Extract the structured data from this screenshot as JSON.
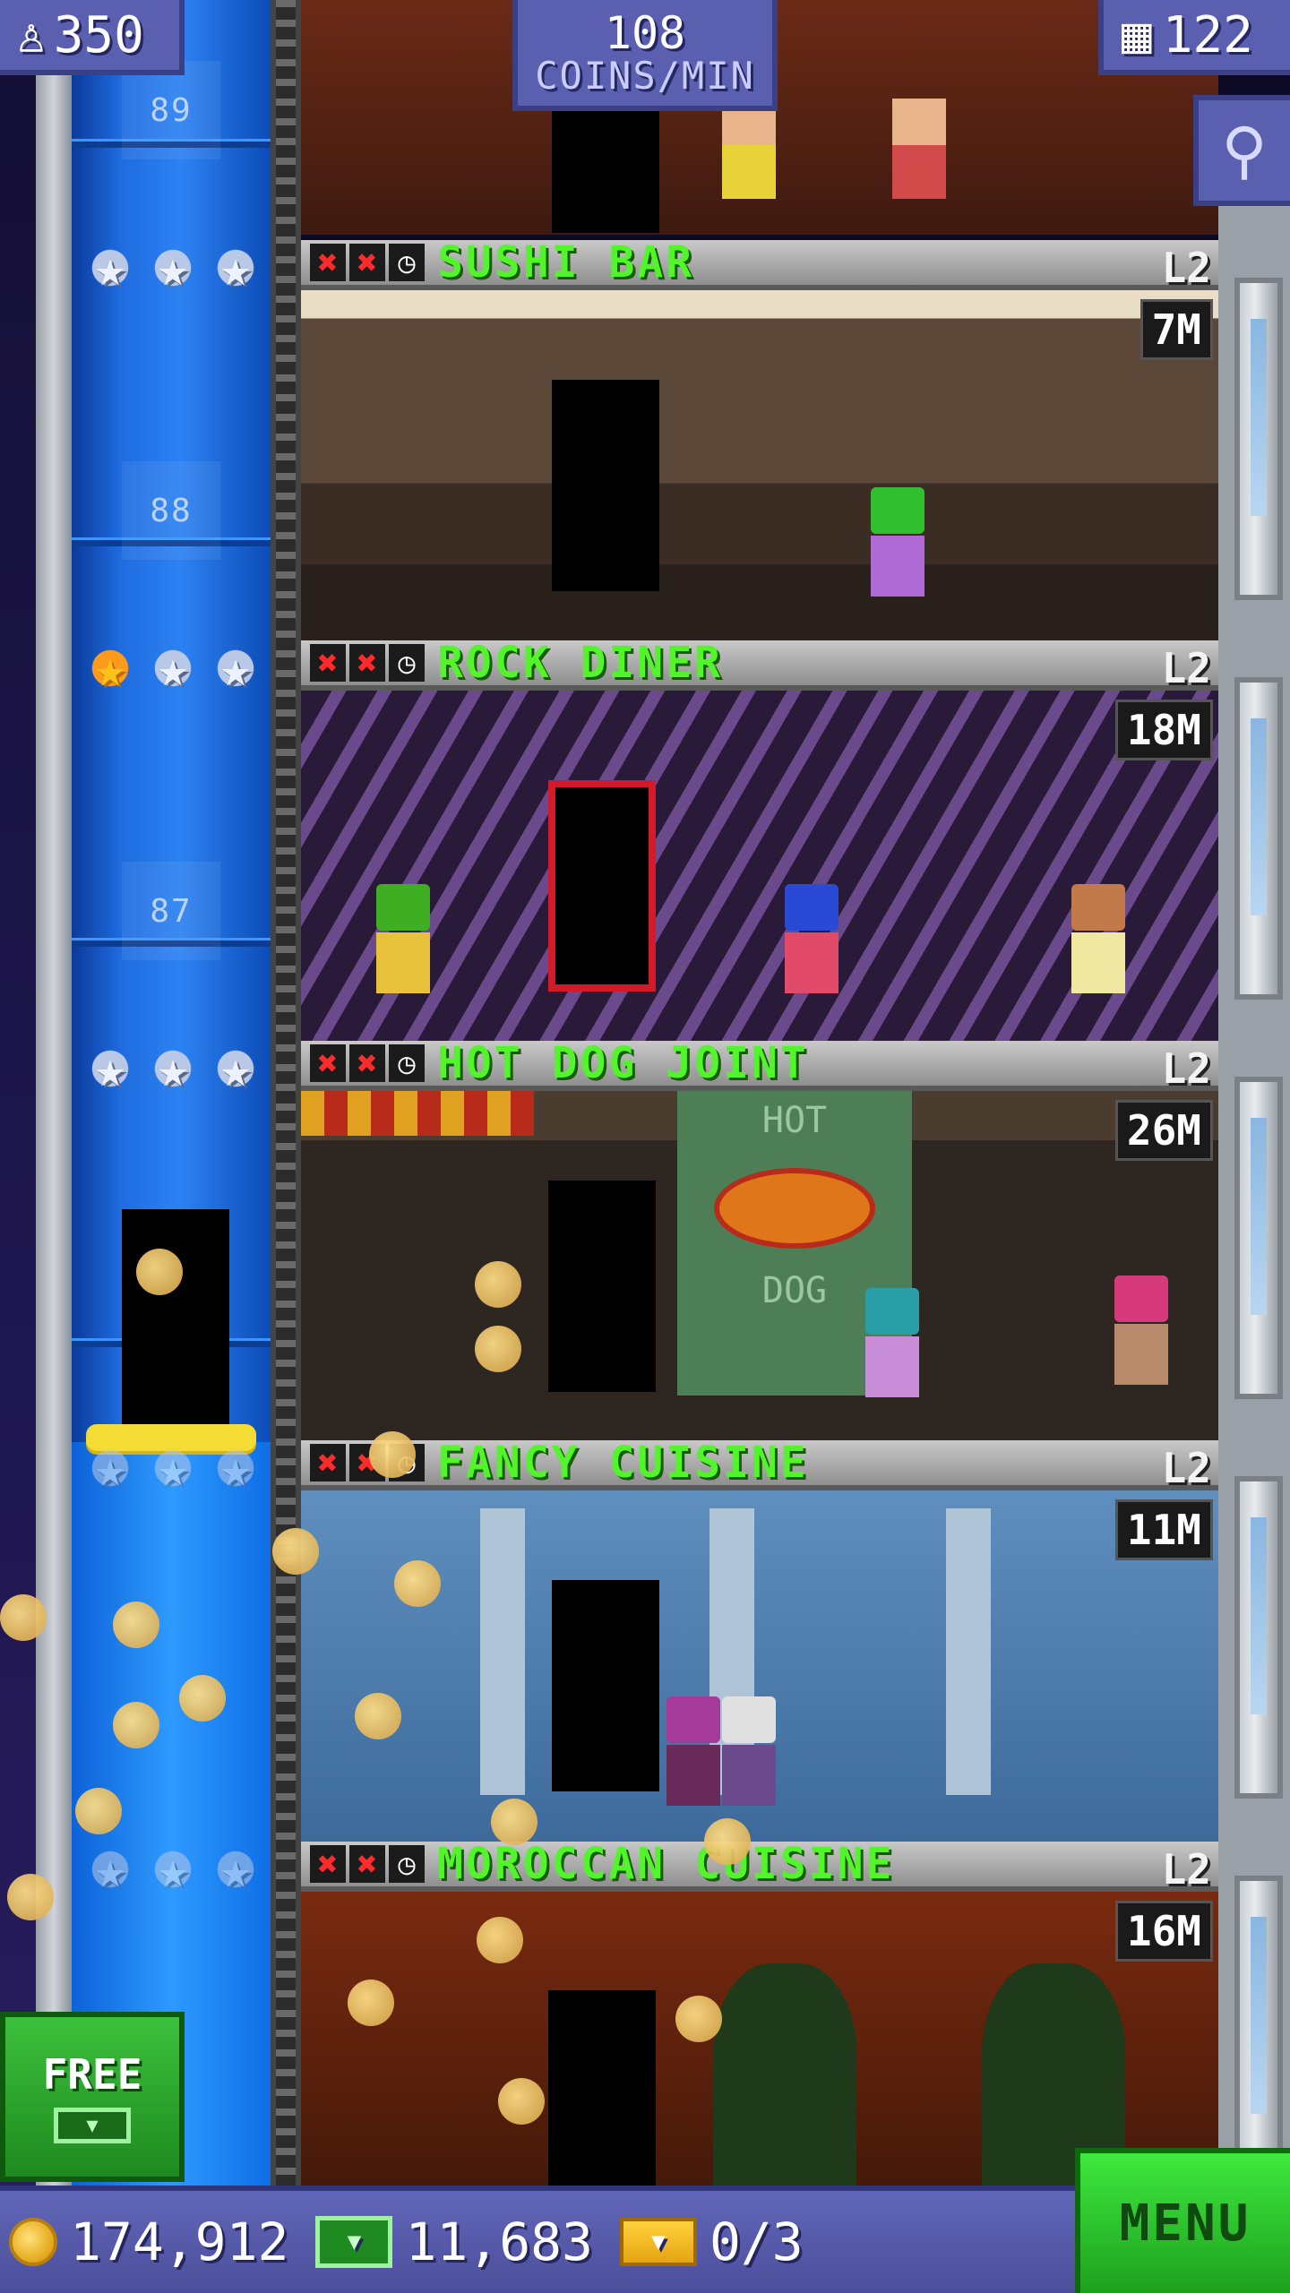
{
  "hud": {
    "population": "350",
    "coins_per_min_value": "108",
    "coins_per_min_unit": "COINS/MIN",
    "floor_count": "122"
  },
  "shaft_floor_numbers": [
    "89",
    "88",
    "87"
  ],
  "floors": [
    {
      "name": "SUSHI BAR",
      "level": "L2",
      "price": "7M",
      "stars": [
        false,
        false,
        false
      ]
    },
    {
      "name": "ROCK DINER",
      "level": "L2",
      "price": "18M",
      "stars": [
        true,
        false,
        false
      ]
    },
    {
      "name": "HOT DOG JOINT",
      "level": "L2",
      "price": "26M",
      "stars": [
        false,
        false,
        false
      ]
    },
    {
      "name": "FANCY CUISINE",
      "level": "L2",
      "price": "11M",
      "stars": [
        false,
        false,
        false
      ]
    },
    {
      "name": "MOROCCAN CUISINE",
      "level": "L2",
      "price": "16M",
      "stars": [
        false,
        false,
        false
      ]
    }
  ],
  "room_signs": {
    "hotdog_top": "HOT",
    "hotdog_bottom": "DOG"
  },
  "free_button": {
    "label": "FREE"
  },
  "bottom": {
    "coins": "174,912",
    "bux": "11,683",
    "tickets": "0/3",
    "menu_label": "MENU"
  },
  "colors": {
    "floor_name": "#52f52a",
    "hud_bg": "#5b5fb0",
    "menu_green": "#3ee83e"
  }
}
